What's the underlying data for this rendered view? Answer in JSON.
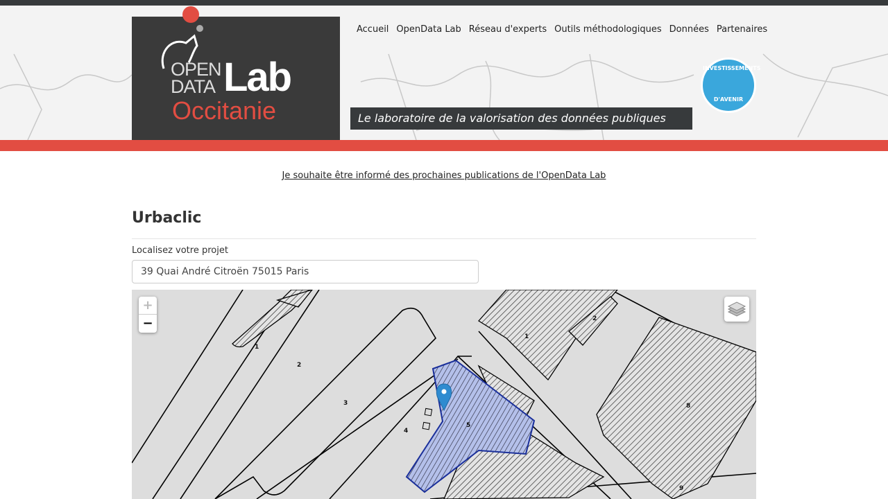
{
  "logo": {
    "line1": "OPEN",
    "line2": "DATA",
    "lab": "Lab",
    "region": "Occitanie"
  },
  "nav": [
    {
      "label": "Accueil"
    },
    {
      "label": "OpenData Lab"
    },
    {
      "label": "Réseau d'experts"
    },
    {
      "label": "Outils méthodologiques"
    },
    {
      "label": "Données"
    },
    {
      "label": "Partenaires"
    }
  ],
  "tagline": "Le laboratoire de la valorisation des données publiques",
  "partner_badge": {
    "top": "INVESTISSEMENTS",
    "bottom": "D'AVENIR"
  },
  "subscribe_link": "Je souhaite être informé des prochaines publications de l'OpenData Lab",
  "page_title": "Urbaclic",
  "locate": {
    "label": "Localisez votre projet",
    "value": "39 Quai André Citroën 75015 Paris"
  },
  "map": {
    "zoom_in": "+",
    "zoom_out": "−",
    "layers_icon": "layers-icon",
    "marker_icon": "map-marker-icon",
    "parcel_labels": [
      "1",
      "2",
      "3",
      "4",
      "5",
      "8",
      "1",
      "2",
      "9"
    ]
  },
  "colors": {
    "accent": "#e24d42",
    "dark": "#373a3c",
    "selection": "#3050c0",
    "badge": "#3aa7dc"
  }
}
